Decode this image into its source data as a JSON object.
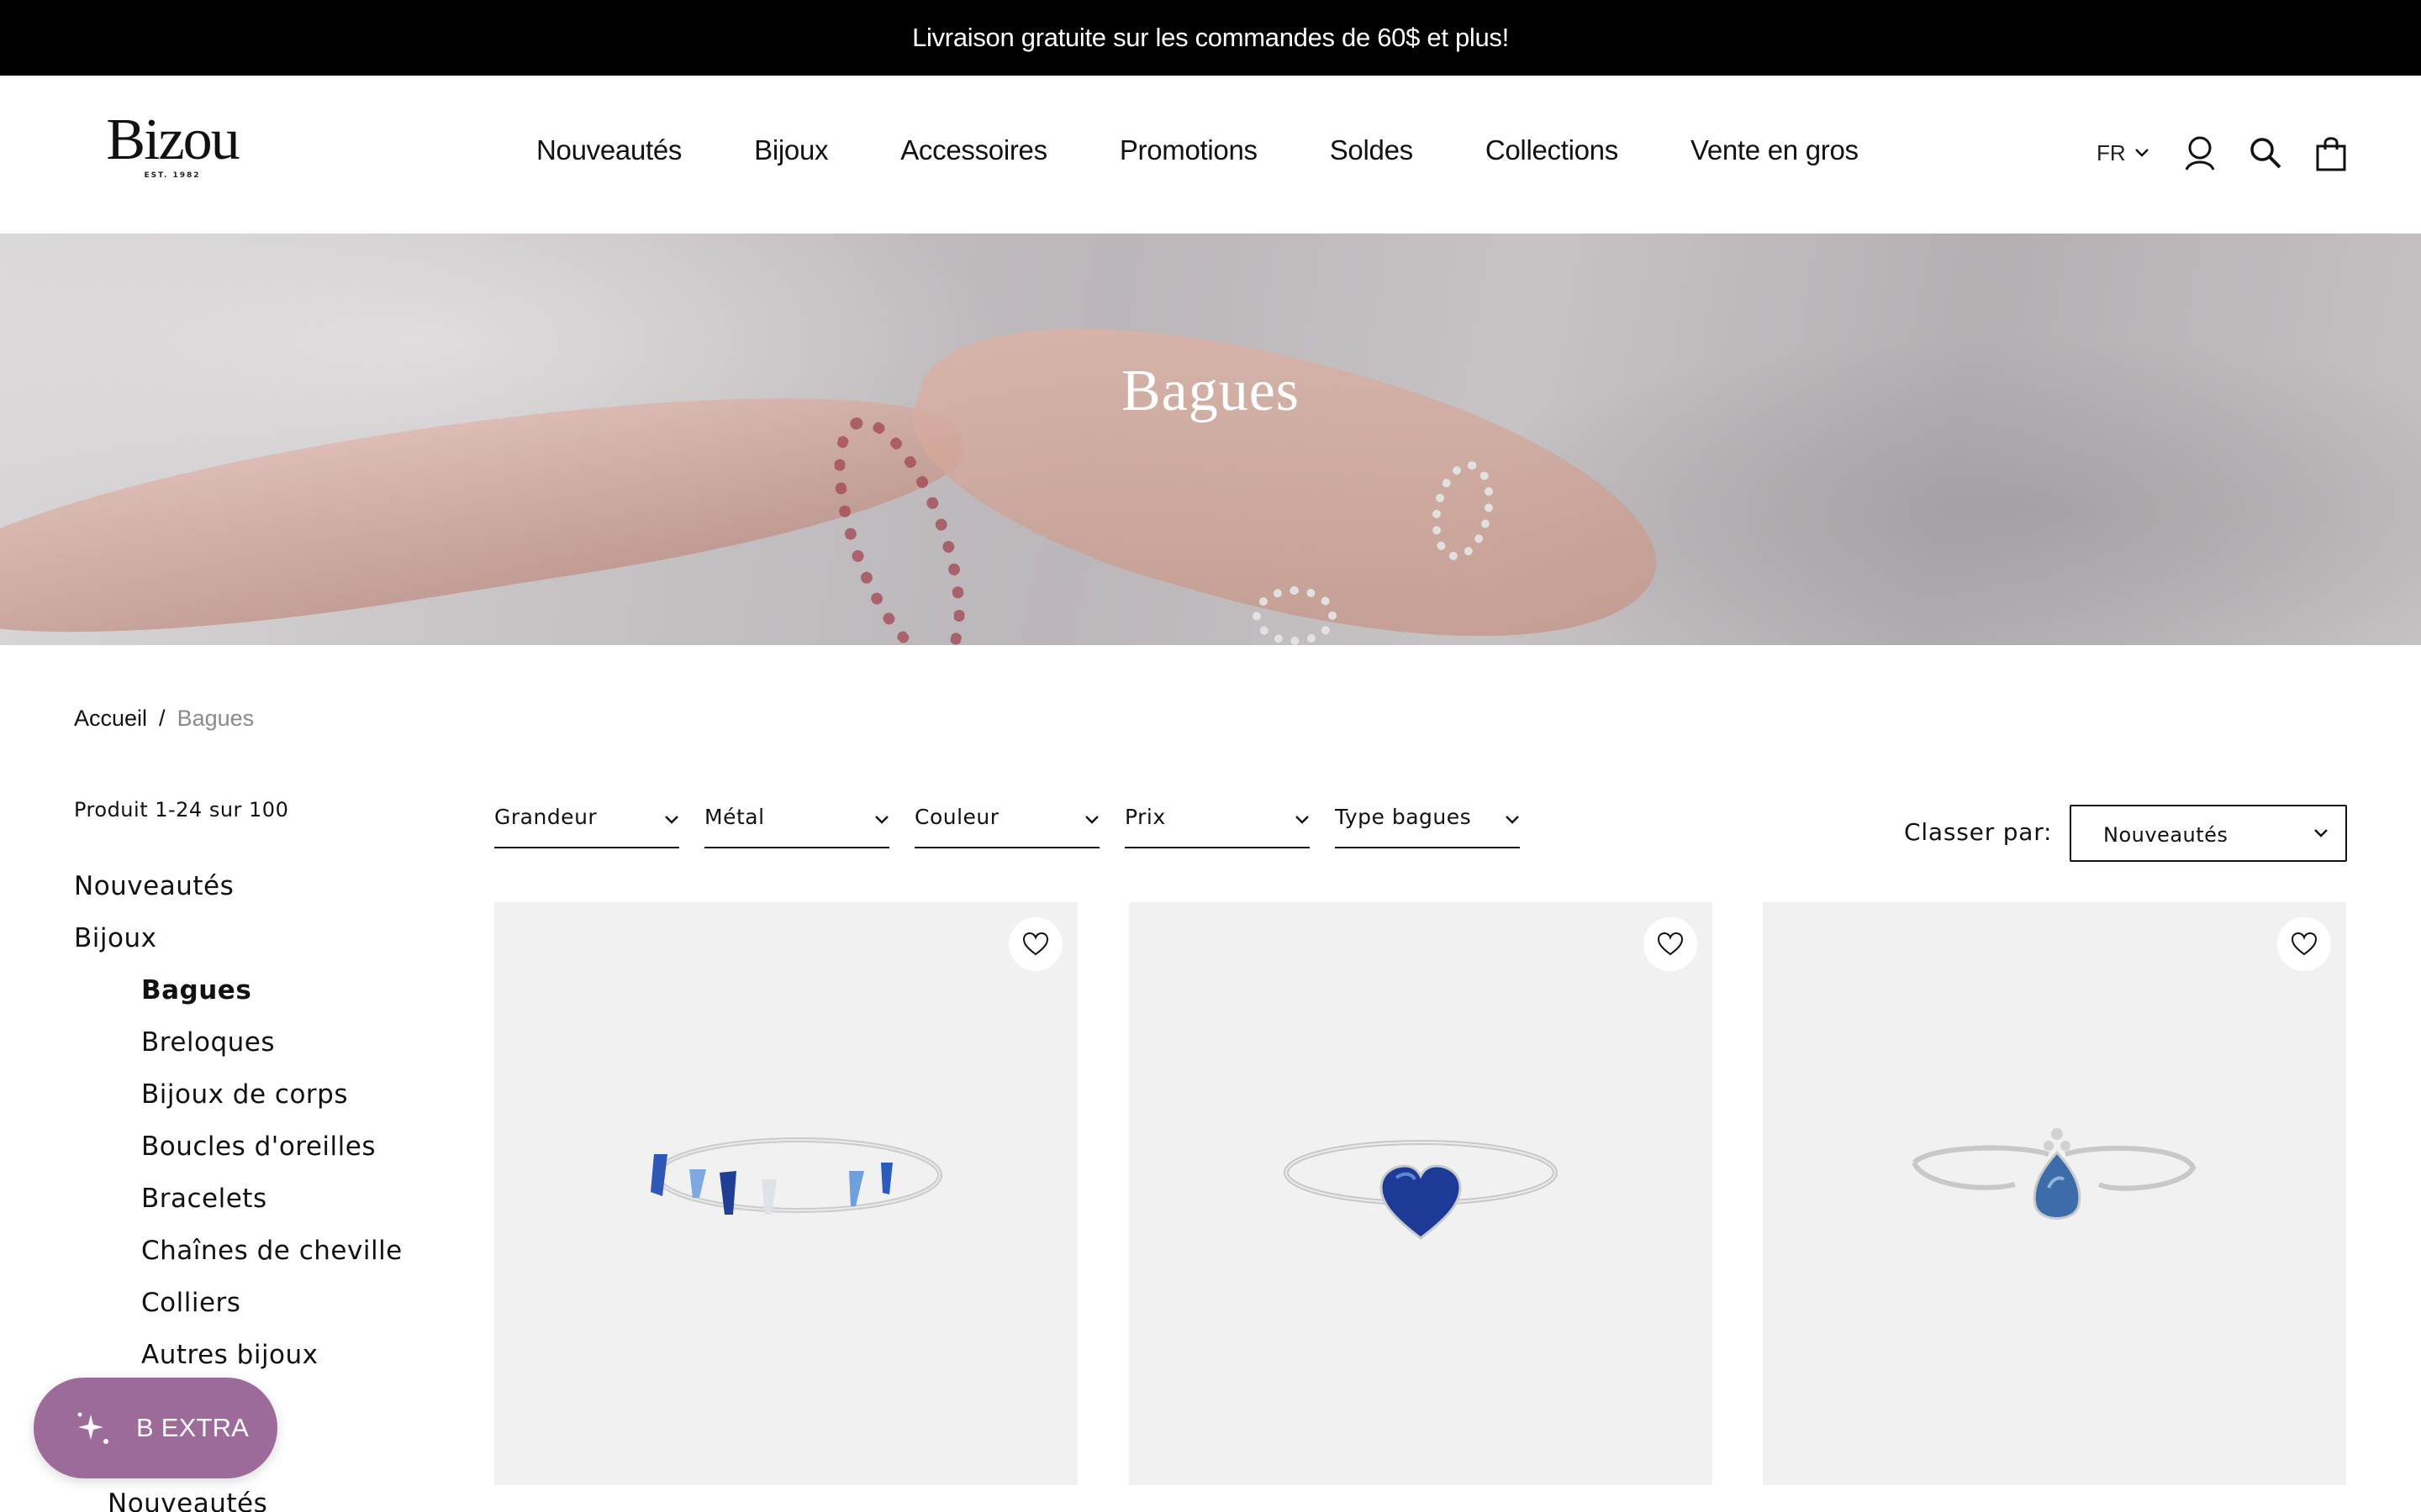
{
  "announcement": "Livraison gratuite sur les commandes de 60$ et plus!",
  "logo": {
    "name": "Bizou",
    "tagline": "EST. 1982"
  },
  "nav": [
    "Nouveautés",
    "Bijoux",
    "Accessoires",
    "Promotions",
    "Soldes",
    "Collections",
    "Vente en gros"
  ],
  "header_tools": {
    "language": "FR",
    "icons": [
      "account-icon",
      "search-icon",
      "cart-icon"
    ]
  },
  "hero": {
    "title": "Bagues"
  },
  "breadcrumb": {
    "home": "Accueil",
    "separator": "/",
    "current": "Bagues"
  },
  "product_count": "Produit 1-24 sur 100",
  "sidebar": {
    "top_items": [
      "Nouveautés",
      "Bijoux"
    ],
    "sub_items": [
      "Bagues",
      "Breloques",
      "Bijoux de corps",
      "Boucles d'oreilles",
      "Bracelets",
      "Chaînes de cheville",
      "Colliers",
      "Autres bijoux"
    ],
    "active": "Bagues",
    "partial_item": "Nouveautés"
  },
  "filters": [
    "Grandeur",
    "Métal",
    "Couleur",
    "Prix",
    "Type bagues"
  ],
  "sort": {
    "label": "Classer par:",
    "selected": "Nouveautés"
  },
  "products": [
    {
      "image": "silver-ring-blue-baguette-stones",
      "wishlist_icon": "heart-icon"
    },
    {
      "image": "silver-ring-blue-heart-stone",
      "wishlist_icon": "heart-icon"
    },
    {
      "image": "silver-ring-blue-teardrop-stone",
      "wishlist_icon": "heart-icon"
    }
  ],
  "extra_button": {
    "label": "B EXTRA",
    "icon": "sparkle-icon",
    "color": "#9c6b9a"
  }
}
